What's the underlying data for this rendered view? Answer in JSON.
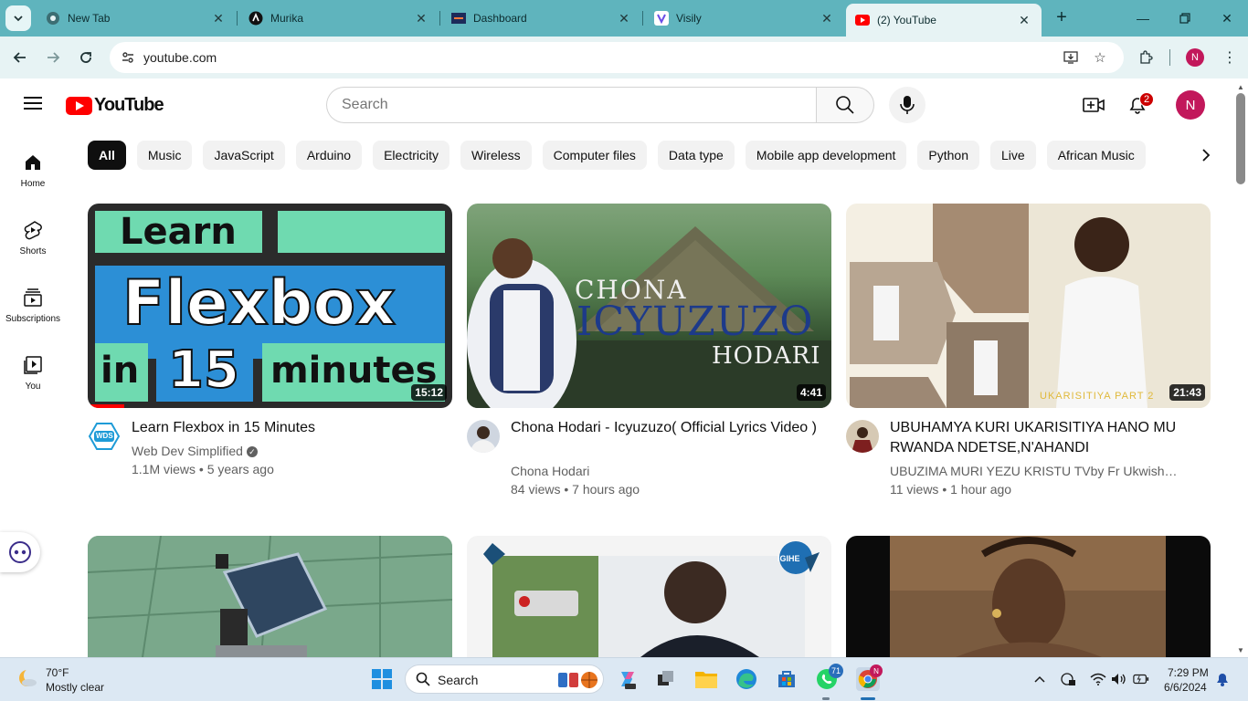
{
  "browser": {
    "tabs": [
      {
        "title": "New Tab",
        "icon": "chrome-icon"
      },
      {
        "title": "Murika",
        "icon": "murika-icon"
      },
      {
        "title": "Dashboard",
        "icon": "dashboard-icon"
      },
      {
        "title": "Visily",
        "icon": "visily-icon"
      },
      {
        "title": "(2) YouTube",
        "icon": "youtube-icon",
        "active": true
      }
    ],
    "new_tab": "+",
    "url": "youtube.com",
    "profile_initial": "N"
  },
  "youtube": {
    "logo_text": "YouTube",
    "search_placeholder": "Search",
    "notifications_count": "2",
    "avatar_initial": "N",
    "guide": [
      {
        "label": "Home",
        "icon": "home-icon"
      },
      {
        "label": "Shorts",
        "icon": "shorts-icon"
      },
      {
        "label": "Subscriptions",
        "icon": "subscriptions-icon"
      },
      {
        "label": "You",
        "icon": "you-icon"
      }
    ],
    "chips": [
      "All",
      "Music",
      "JavaScript",
      "Arduino",
      "Electricity",
      "Wireless",
      "Computer files",
      "Data type",
      "Mobile app development",
      "Python",
      "Live",
      "African Music"
    ],
    "videos": [
      {
        "title": "Learn Flexbox in 15 Minutes",
        "channel": "Web Dev Simplified",
        "meta": "1.1M views • 5 years ago",
        "duration": "15:12",
        "thumb_text": {
          "l1": "Learn",
          "l2": "Flexbox",
          "l3a": "in",
          "l3b": "15",
          "l3c": "minutes"
        },
        "avatar_text": "WDS"
      },
      {
        "title": "Chona Hodari - Icyuzuzo( Official Lyrics Video )",
        "channel": "Chona Hodari",
        "meta": "84 views • 7 hours ago",
        "duration": "4:41",
        "thumb_text": {
          "l1": "CHONA",
          "l2": "ICYUZUZO",
          "l3": "HODARI"
        }
      },
      {
        "title": "UBUHAMYA KURI UKARISITIYA HANO MU RWANDA NDETSE,N'AHANDI",
        "channel": "UBUZIMA MURI YEZU KRISTU TVby Fr Ukwishaka ...",
        "meta": "11 views • 1 hour ago",
        "duration": "21:43",
        "thumb_text": {
          "l1": "UKARISITIYA PART 2"
        }
      }
    ],
    "row2_badge": "IGIHE"
  },
  "taskbar": {
    "weather_temp": "70°F",
    "weather_desc": "Mostly clear",
    "search_label": "Search",
    "whatsapp_badge": "71",
    "chrome_badge": "N",
    "time": "7:29 PM",
    "date": "6/6/2024"
  }
}
